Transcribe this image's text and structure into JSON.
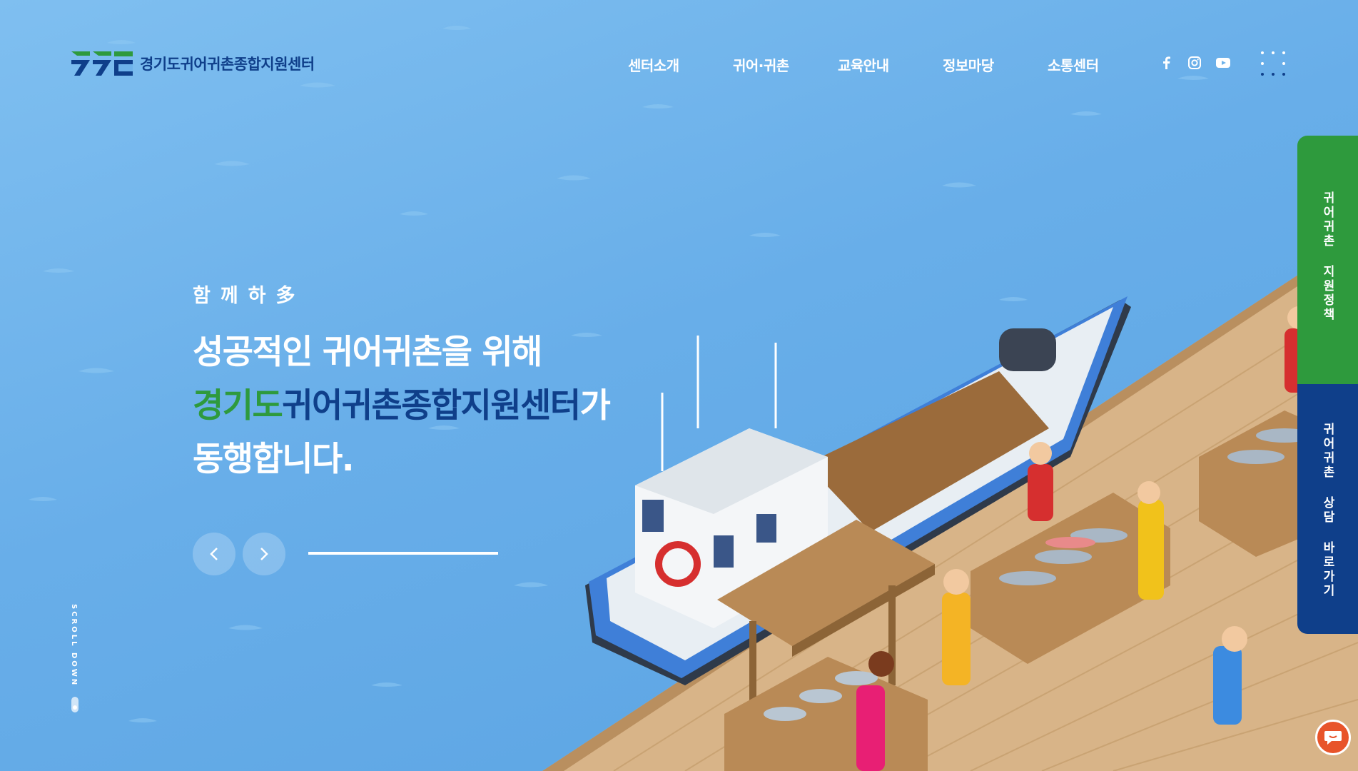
{
  "brand": {
    "name": "경기도귀어귀촌종합지원센터",
    "green": "#2e9a3d",
    "navy": "#0f3f8a"
  },
  "nav": {
    "items": [
      {
        "label": "센터소개"
      },
      {
        "label": "귀어·귀촌"
      },
      {
        "label": "교육안내"
      },
      {
        "label": "정보마당"
      },
      {
        "label": "소통센터"
      }
    ]
  },
  "social": [
    "facebook-icon",
    "instagram-icon",
    "youtube-icon"
  ],
  "hero": {
    "eyebrow": "함께하多",
    "line1": "성공적인 귀어귀촌을 위해",
    "line2_green": "경기도",
    "line2_navy": "귀어귀촌종합지원센터",
    "line2_end": "가",
    "line3": "동행합니다.",
    "slide_progress": 1.0
  },
  "scroll": {
    "label": "SCROLL DOWN"
  },
  "side_tabs": {
    "policy": "귀어귀촌 지원정책",
    "consult": "귀어귀촌 상담 바로가기"
  }
}
